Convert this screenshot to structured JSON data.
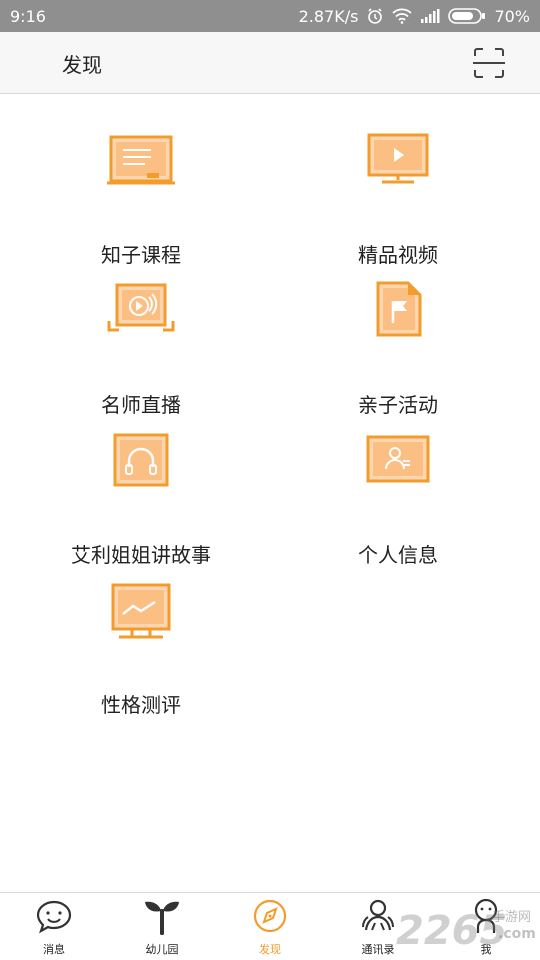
{
  "status_bar": {
    "time": "9:16",
    "speed": "2.87K/s",
    "battery": "70%",
    "icons": [
      "alarm-icon",
      "wifi-icon",
      "signal-icon",
      "battery-icon"
    ]
  },
  "header": {
    "title": "发现",
    "scan_icon": "scan-icon"
  },
  "grid": {
    "items": [
      {
        "label": "知子课程",
        "icon": "course-board-icon"
      },
      {
        "label": "精品视频",
        "icon": "video-monitor-icon"
      },
      {
        "label": "名师直播",
        "icon": "live-broadcast-icon"
      },
      {
        "label": "亲子活动",
        "icon": "activity-flag-icon"
      },
      {
        "label": "艾利姐姐讲故事",
        "icon": "headphones-icon"
      },
      {
        "label": "个人信息",
        "icon": "profile-card-icon"
      },
      {
        "label": "性格测评",
        "icon": "chart-monitor-icon"
      }
    ]
  },
  "tabbar": {
    "items": [
      {
        "label": "消息",
        "icon": "message-bubble-icon"
      },
      {
        "label": "幼儿园",
        "icon": "sprout-icon"
      },
      {
        "label": "发现",
        "icon": "compass-icon",
        "active": true
      },
      {
        "label": "通讯录",
        "icon": "contacts-icon"
      },
      {
        "label": "我",
        "icon": "person-icon"
      }
    ]
  },
  "watermark": {
    "number": "2265",
    "site": "手游网",
    "suffix": ".com"
  },
  "colors": {
    "accent": "#f39c2c",
    "icon_fill": "#fbbf84",
    "status_bar": "#8f8f8f"
  }
}
